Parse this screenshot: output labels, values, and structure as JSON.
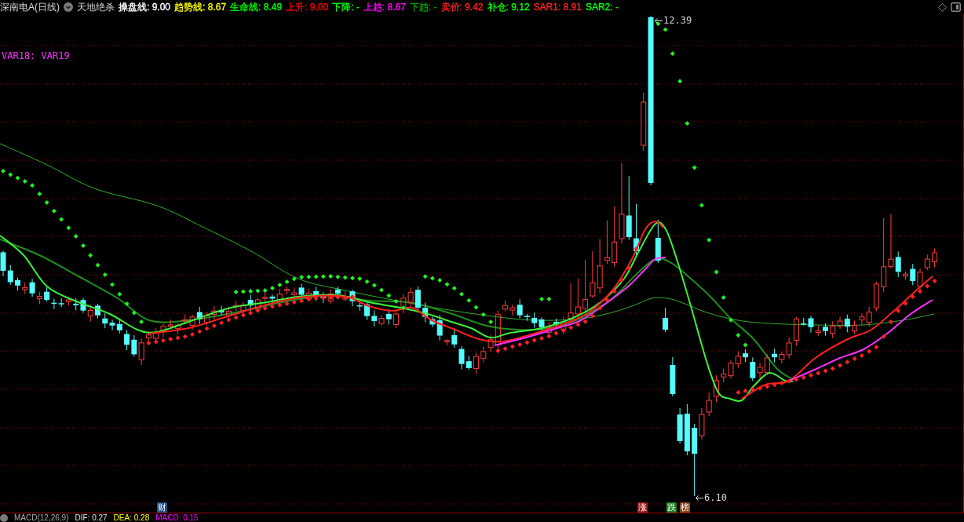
{
  "header": {
    "security": "深南电A(日线)",
    "indicator": "天地绝杀",
    "readings": [
      {
        "text": "操盘线: 9.00",
        "color": "#ffffff"
      },
      {
        "text": "趋势线: 8.67",
        "color": "#ffff00"
      },
      {
        "text": "生命线: 8.49",
        "color": "#00ff00"
      },
      {
        "text": "上升: 9.00",
        "color": "#ff0000"
      },
      {
        "text": "下降: -",
        "color": "#00ff00"
      },
      {
        "text": "上趋: 8.67",
        "color": "#ff00ff"
      },
      {
        "text": "下趋: -",
        "color": "#00a000"
      },
      {
        "text": "卖价: 9.42",
        "color": "#ff2020"
      },
      {
        "text": "补仓: 9.12",
        "color": "#00ff00"
      },
      {
        "text": "SAR1: 8.91",
        "color": "#ff2020"
      },
      {
        "text": "SAR2: -",
        "color": "#00ff00"
      }
    ]
  },
  "overlay_legend": "VAR18: VAR19",
  "chart": {
    "high_label": "12.39",
    "low_label": "6.10",
    "event_tags": [
      {
        "label": "财",
        "color": "#1c4f86"
      },
      {
        "label": "涨",
        "color": "#9b1b1b"
      },
      {
        "label": "跌",
        "color": "#1e7d1e"
      },
      {
        "label": "榜",
        "color": "#8b4513"
      }
    ]
  },
  "macd_legend": {
    "title": "MACD(12,26,9)",
    "readings": [
      {
        "text": "DIF: 0.27",
        "color": "#e0e0e0"
      },
      {
        "text": "DEA: 0.28",
        "color": "#ffff00"
      },
      {
        "text": "MACD: 0.15",
        "color": "#ff00ff"
      }
    ]
  }
}
